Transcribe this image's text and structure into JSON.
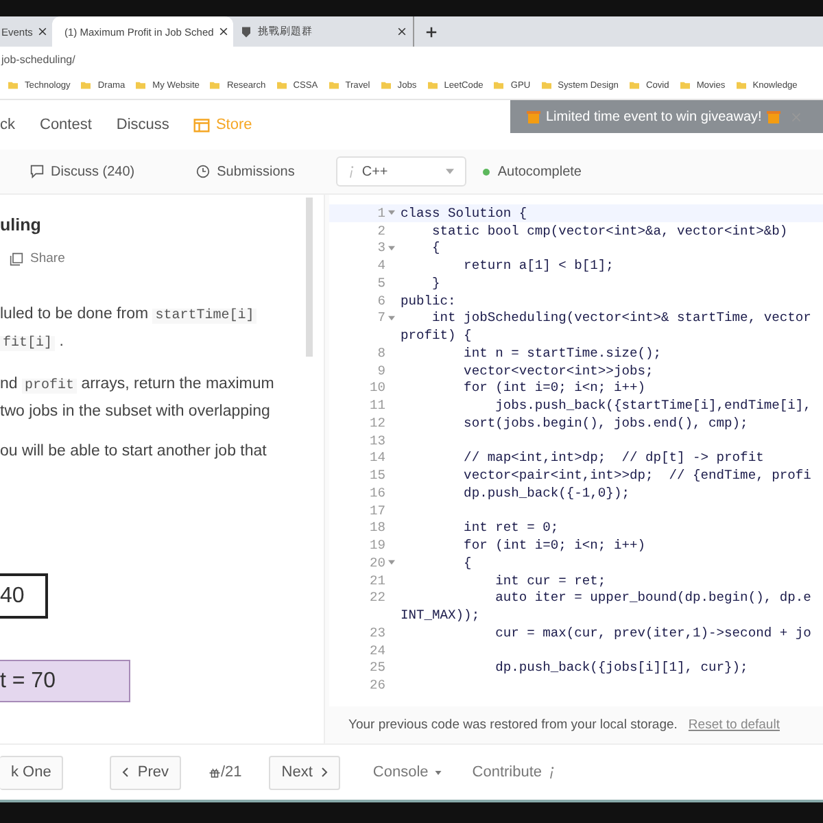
{
  "browser": {
    "tabs": [
      {
        "title": "Events",
        "selected": false
      },
      {
        "title": "(1) Maximum Profit in Job Sched",
        "selected": true
      },
      {
        "title": "挑戰刷題群",
        "selected": false
      }
    ],
    "url": "job-scheduling/",
    "bookmarks": [
      "Technology",
      "Drama",
      "My Website",
      "Research",
      "CSSA",
      "Travel",
      "Jobs",
      "LeetCode",
      "GPU",
      "System Design",
      "Covid",
      "Movies",
      "Knowledge"
    ]
  },
  "nav": {
    "items": [
      "ck",
      "Contest",
      "Discuss"
    ],
    "store": "Store",
    "banner": "Limited time event to win giveaway!"
  },
  "toolbar": {
    "discuss": "Discuss (240)",
    "submissions": "Submissions",
    "language": "C++",
    "autocomplete": "Autocomplete"
  },
  "problem": {
    "title": "uling",
    "share": "Share",
    "lines": [
      [
        {
          "t": "luled to be done from ",
          "kind": "text"
        },
        {
          "t": "startTime[i]",
          "kind": "code"
        }
      ],
      [
        {
          "t": "fit[i]",
          "kind": "code"
        },
        {
          "t": " .",
          "kind": "text"
        }
      ],
      [
        {
          "t": "nd ",
          "kind": "text"
        },
        {
          "t": "profit",
          "kind": "code"
        },
        {
          "t": " arrays, return the maximum",
          "kind": "text"
        }
      ],
      [
        {
          "t": " two jobs in the subset with overlapping",
          "kind": "text"
        }
      ],
      [
        {
          "t": "ou will be able to start another job that",
          "kind": "text"
        }
      ]
    ],
    "diagram": {
      "job_a": "40",
      "job_b": "t = 70"
    }
  },
  "editor": {
    "lines": [
      {
        "number": "1",
        "foldable": true,
        "text": "class Solution {"
      },
      {
        "number": "2",
        "foldable": false,
        "text": "    static bool cmp(vector<int>&a, vector<int>&b)"
      },
      {
        "number": "3",
        "foldable": true,
        "text": "    {"
      },
      {
        "number": "4",
        "foldable": false,
        "text": "        return a[1] < b[1];"
      },
      {
        "number": "5",
        "foldable": false,
        "text": "    }"
      },
      {
        "number": "6",
        "foldable": false,
        "text": "public:"
      },
      {
        "number": "7",
        "foldable": true,
        "text": "    int jobScheduling(vector<int>& startTime, vector"
      },
      {
        "foldable": false,
        "text": "profit) {"
      },
      {
        "number": "8",
        "foldable": false,
        "text": "        int n = startTime.size();"
      },
      {
        "number": "9",
        "foldable": false,
        "text": "        vector<vector<int>>jobs;"
      },
      {
        "number": "10",
        "foldable": false,
        "text": "        for (int i=0; i<n; i++)"
      },
      {
        "number": "11",
        "foldable": false,
        "text": "            jobs.push_back({startTime[i],endTime[i],"
      },
      {
        "number": "12",
        "foldable": false,
        "text": "        sort(jobs.begin(), jobs.end(), cmp);"
      },
      {
        "number": "13",
        "foldable": false
      },
      {
        "number": "14",
        "foldable": false,
        "text": "        // map<int,int>dp;  // dp[t] -> profit"
      },
      {
        "number": "15",
        "foldable": false,
        "text": "        vector<pair<int,int>>dp;  // {endTime, profi"
      },
      {
        "number": "16",
        "foldable": false,
        "text": "        dp.push_back({-1,0});"
      },
      {
        "number": "17",
        "foldable": false
      },
      {
        "number": "18",
        "foldable": false,
        "text": "        int ret = 0;"
      },
      {
        "number": "19",
        "foldable": false,
        "text": "        for (int i=0; i<n; i++)"
      },
      {
        "number": "20",
        "foldable": true,
        "text": "        {"
      },
      {
        "number": "21",
        "foldable": false,
        "text": "            int cur = ret;"
      },
      {
        "number": "22",
        "foldable": false,
        "text": "            auto iter = upper_bound(dp.begin(), dp.e"
      },
      {
        "foldable": false,
        "text": "INT_MAX));"
      },
      {
        "number": "23",
        "foldable": false,
        "text": "            cur = max(cur, prev(iter,1)->second + jo"
      },
      {
        "number": "24",
        "foldable": false
      },
      {
        "number": "25",
        "foldable": false,
        "text": "            dp.push_back({jobs[i][1], cur});"
      },
      {
        "number": "26",
        "foldable": false
      }
    ],
    "notice": "Your previous code was restored from your local storage.",
    "reset": "Reset to default"
  },
  "footer": {
    "pick": "k One",
    "prev": "Prev",
    "counter": "/21",
    "next": "Next",
    "console": "Console",
    "contribute": "Contribute"
  }
}
